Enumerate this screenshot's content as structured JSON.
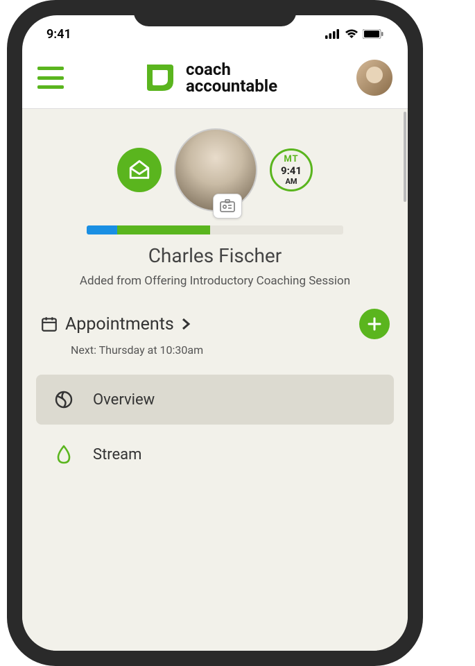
{
  "status": {
    "time": "9:41"
  },
  "brand": {
    "line1": "coach",
    "line2": "accountable"
  },
  "timezone": {
    "tz": "MT",
    "time": "9:41",
    "ampm": "AM"
  },
  "progress": {
    "seg1_pct": 12,
    "seg2_pct": 36
  },
  "client": {
    "name": "Charles Fischer",
    "note": "Added from Offering Introductory Coaching Session"
  },
  "appointments": {
    "label": "Appointments",
    "next_prefix": "Next: ",
    "next_value": "Thursday at 10:30am"
  },
  "menu": {
    "overview": "Overview",
    "stream": "Stream"
  },
  "colors": {
    "accent": "#5ab51e",
    "blue": "#1a8fe3"
  }
}
